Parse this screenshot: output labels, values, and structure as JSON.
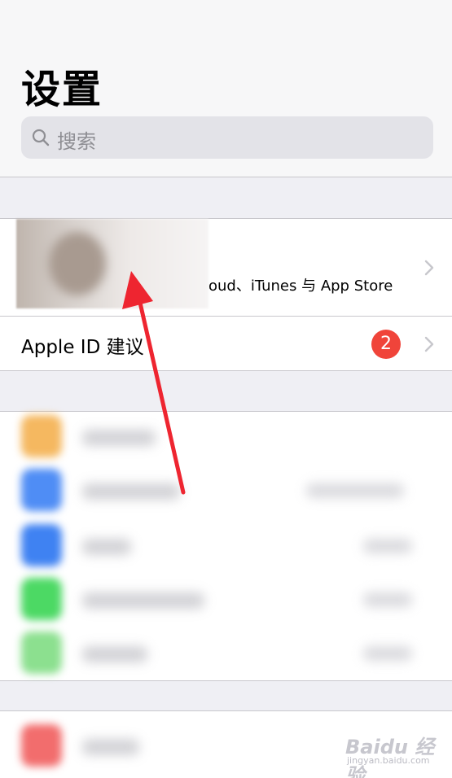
{
  "header": {
    "title": "设置",
    "search": {
      "placeholder": "搜索"
    }
  },
  "account": {
    "profile_subtitle": "oud、iTunes 与 App Store",
    "apple_id_label": "Apple ID 建议",
    "badge_count": "2"
  },
  "colors": {
    "accent_red": "#f0443a",
    "background": "#efeff4",
    "separator": "#c8c7cc"
  },
  "watermark": {
    "brand": "Baidu 经验",
    "url": "jingyan.baidu.com"
  }
}
